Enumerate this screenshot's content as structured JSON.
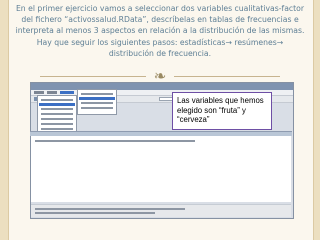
{
  "slide": {
    "intro_text": "En el primer ejercicio vamos a seleccionar dos variables cualitativas-factor del fichero “activossalud.RData”, descríbelas en tablas de frecuencias e interpreta al menos 3 aspectos en relación a la distribución de las mismas. Hay que seguir los siguientes pasos: estadísticas→ resúmenes→ distribución de frecuencia.",
    "ornament": "❧",
    "callout_text": "Las variables que hemos elegido son “fruta” y “cerveza”"
  },
  "colors": {
    "slide_text": "#5e7f95",
    "callout_border": "#6e4fa5",
    "menu_highlight": "#3b6fc4",
    "background": "#ecdfc0"
  }
}
